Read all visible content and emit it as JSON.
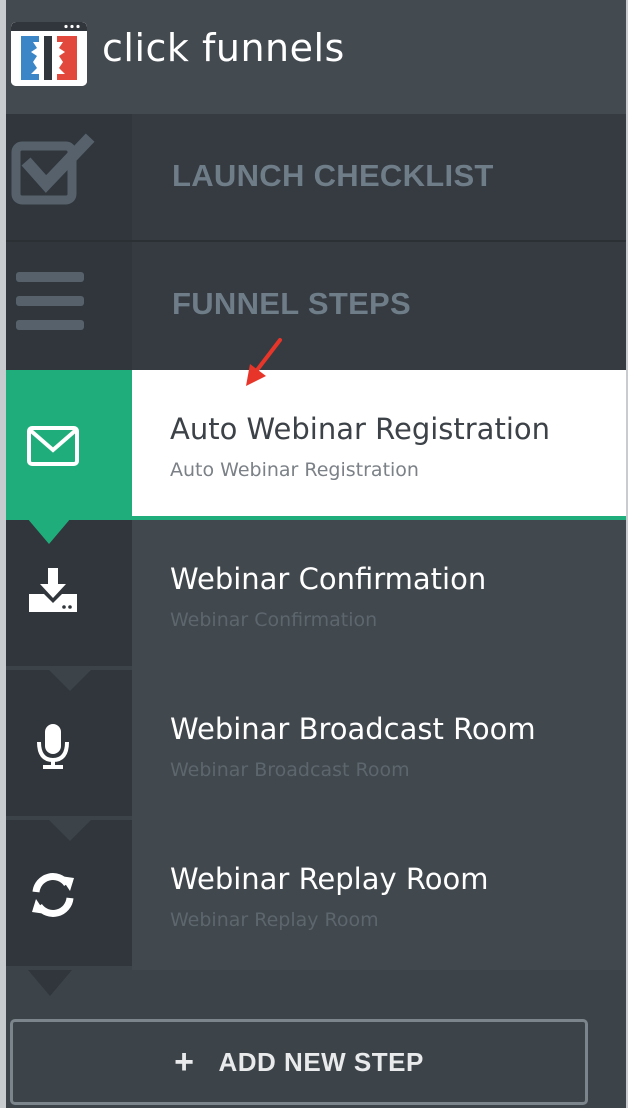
{
  "brand": {
    "name": "click funnels"
  },
  "nav": {
    "launch_checklist": "LAUNCH CHECKLIST",
    "funnel_steps": "FUNNEL STEPS"
  },
  "steps": [
    {
      "title": "Auto Webinar Registration",
      "subtitle": "Auto Webinar Registration",
      "icon": "envelope-icon",
      "active": true
    },
    {
      "title": "Webinar Confirmation",
      "subtitle": "Webinar Confirmation",
      "icon": "download-icon",
      "active": false
    },
    {
      "title": "Webinar Broadcast Room",
      "subtitle": "Webinar Broadcast Room",
      "icon": "microphone-icon",
      "active": false
    },
    {
      "title": "Webinar Replay Room",
      "subtitle": "Webinar Replay Room",
      "icon": "refresh-icon",
      "active": false
    }
  ],
  "add_step": {
    "label": "ADD NEW STEP",
    "icon": "plus-icon"
  },
  "colors": {
    "accent_green": "#1fae7b",
    "annotation_red": "#e8352a"
  }
}
